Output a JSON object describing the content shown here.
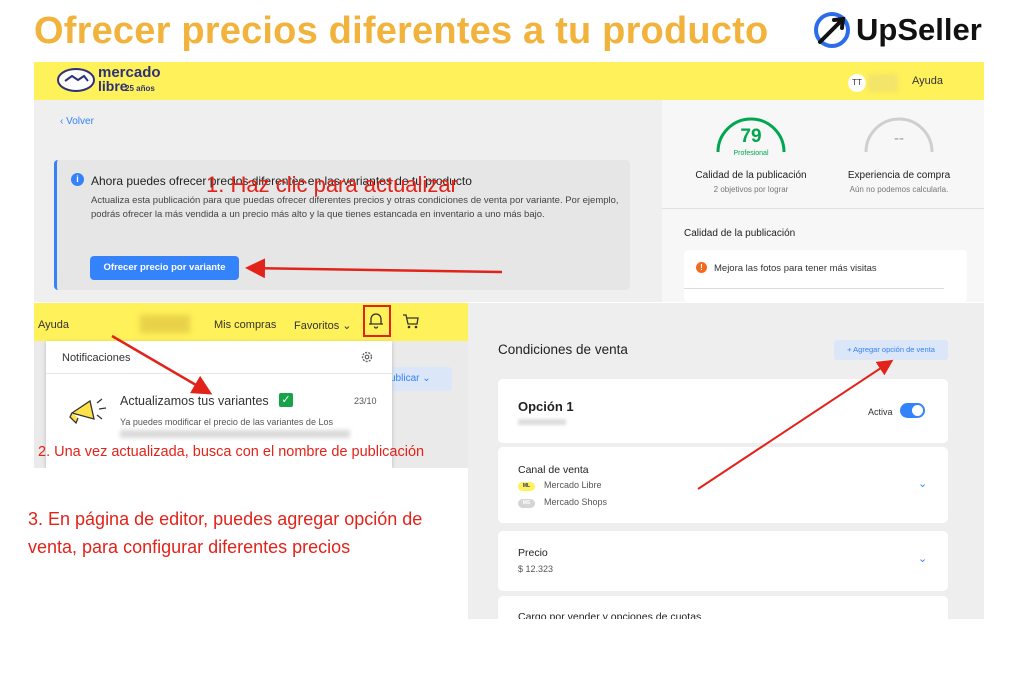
{
  "headline": "Ofrecer precios diferentes a tu producto",
  "brand": {
    "name": "UpSeller",
    "accent": "#f2b33d",
    "logo_icon": "upseller-rocket-icon"
  },
  "panel1": {
    "logo": {
      "line1": "mercado",
      "line2": "libre",
      "line3": "25 años",
      "icon": "handshake-icon"
    },
    "user_initials": "TT",
    "help": "Ayuda",
    "back": "‹  Volver",
    "info": {
      "icon": "info-icon",
      "title": "Ahora puedes ofrecer precios diferentes en las variantes de tu producto",
      "body": "Actualiza esta publicación para que puedas ofrecer diferentes precios y otras condiciones de venta por variante. Por ejemplo, podrás ofrecer la más vendida a un precio más alto y la que tienes estancada en inventario a uno más bajo.",
      "button": "Ofrecer precio por variante"
    },
    "quality": {
      "score": "79",
      "level": "Profesional",
      "title": "Calidad de la publicación",
      "subtitle": "2 objetivos por lograr"
    },
    "experience": {
      "score": "--",
      "title": "Experiencia de compra",
      "subtitle": "Aún no podemos calcularla."
    },
    "section_title": "Calidad de la publicación",
    "tip": "Mejora las fotos para tener más visitas"
  },
  "steps": {
    "step1": "1. Haz clic para actualizar",
    "step2": "2. Una vez actualizada, busca con el nombre de publicación",
    "step3": "3. En página de editor, puedes agregar opción de venta, para configurar diferentes precios"
  },
  "panel2": {
    "help": "Ayuda",
    "mis_compras": "Mis compras",
    "favoritos": "Favoritos ⌄",
    "bell_icon": "bell-icon",
    "cart_icon": "cart-icon",
    "notifications": {
      "title": "Notificaciones",
      "gear_icon": "gear-icon",
      "item": {
        "icon": "megaphone-icon",
        "title": "Actualizamos tus variantes",
        "check": "✓",
        "date": "23/10",
        "body": "Ya puedes modificar el precio de las variantes de Los"
      }
    },
    "publicar": "ublicar ⌄"
  },
  "panel3": {
    "title": "Condiciones de venta",
    "add_option": "+ Agregar opción de venta",
    "option": {
      "label": "Opción 1",
      "active_label": "Activa",
      "active": true
    },
    "channel": {
      "title": "Canal de venta",
      "items": [
        {
          "chip": "ML",
          "label": "Mercado Libre"
        },
        {
          "chip": "MS",
          "label": "Mercado Shops"
        }
      ]
    },
    "price": {
      "title": "Precio",
      "value": "$ 12.323"
    },
    "cargo": "Cargo por vender y opciones de cuotas",
    "chevron": "⌄"
  },
  "colors": {
    "ml_yellow": "#fff159",
    "ml_blue": "#3483fa",
    "annotation_red": "#e2231a",
    "quality_green": "#00a650"
  }
}
